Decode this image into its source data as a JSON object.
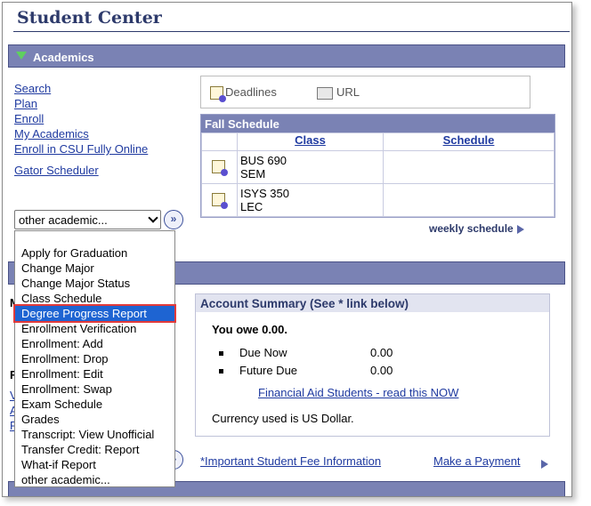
{
  "page": {
    "title": "Student Center"
  },
  "academics": {
    "header": "Academics",
    "links": [
      "Search",
      "Plan",
      "Enroll",
      "My Academics",
      "Enroll in CSU Fully Online"
    ],
    "gator": "Gator Scheduler",
    "select_value": "other academic...",
    "dropdown_options": [
      "Apply for Graduation",
      "Change Major",
      "Change Major Status",
      "Class Schedule",
      "Degree Progress Report",
      "Enrollment Verification",
      "Enrollment: Add",
      "Enrollment: Drop",
      "Enrollment: Edit",
      "Enrollment: Swap",
      "Exam Schedule",
      "Grades",
      "Transcript: View Unofficial",
      "Transfer Credit: Report",
      "What-if Report",
      "other academic..."
    ],
    "selected_option": "Degree Progress Report"
  },
  "toolbox": {
    "deadlines": "Deadlines",
    "url": "URL"
  },
  "schedule": {
    "title": "Fall Schedule",
    "col_class": "Class",
    "col_schedule": "Schedule",
    "rows": [
      {
        "course": "BUS 690",
        "type": "SEM"
      },
      {
        "course": "ISYS 350",
        "type": "LEC"
      }
    ],
    "weekly": "weekly schedule"
  },
  "account": {
    "title": "Account Summary (See * link below)",
    "owe": "You owe 0.00.",
    "due_now_label": "Due Now",
    "due_now_amount": "0.00",
    "future_due_label": "Future Due",
    "future_due_amount": "0.00",
    "fin_aid_link": "Financial Aid Students - read this NOW",
    "currency": "Currency used is US Dollar."
  },
  "footer_links": {
    "fee_info": "*Important Student Fee Information",
    "make_payment": "Make a Payment"
  },
  "left_fragments": [
    "M",
    "F",
    "V",
    "A",
    "F"
  ],
  "colors": {
    "bar": "#7a82b4",
    "link": "#1f3aa0",
    "highlight": "#1e64d2",
    "callout": "#e23a3a"
  }
}
